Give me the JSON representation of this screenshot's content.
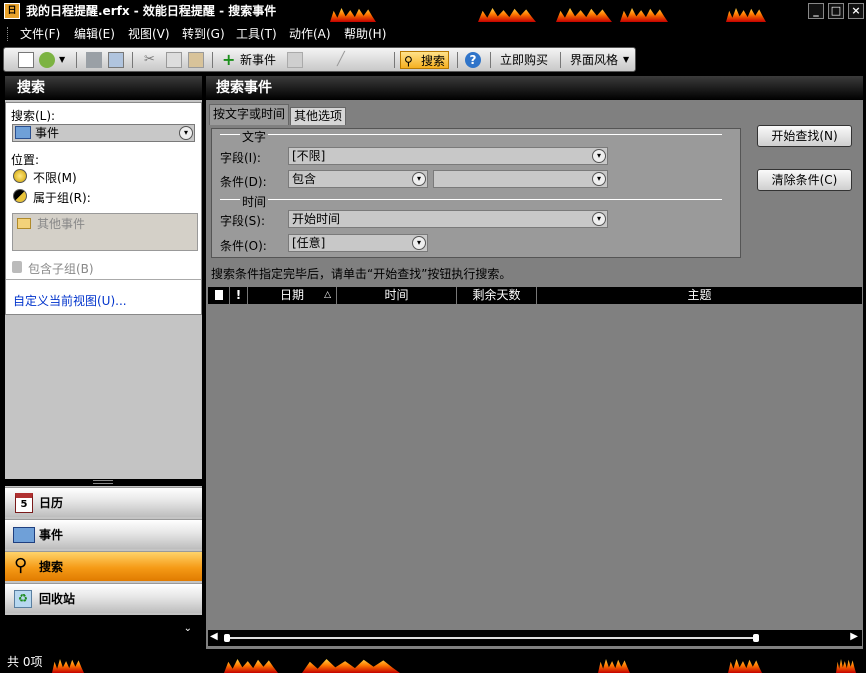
{
  "window": {
    "app_icon_text": "日",
    "title": "我的日程提醒.erfx - 效能日程提醒 - 搜索事件",
    "controls": [
      "_",
      "□",
      "×"
    ]
  },
  "menu": [
    "文件(F)",
    "编辑(E)",
    "视图(V)",
    "转到(G)",
    "工具(T)",
    "动作(A)",
    "帮助(H)"
  ],
  "toolbar": {
    "new_event": "新事件",
    "search": "搜索",
    "buy_now": "立即购买",
    "theme": "界面风格"
  },
  "sidebar": {
    "header": "搜索",
    "search_label": "搜索(L):",
    "search_value": "事件",
    "position_label": "位置:",
    "option_unlimited": "不限(M)",
    "option_group": "属于组(R):",
    "group_item": "其他事件",
    "include_subgroups": "包含子组(B)",
    "customize_link": "自定义当前视图(U)...",
    "nav": [
      "日历",
      "事件",
      "搜索",
      "回收站"
    ],
    "active_nav": "搜索",
    "calendar_icon_day": "5"
  },
  "main": {
    "header": "搜索事件",
    "tabs": [
      "按文字或时间",
      "其他选项"
    ],
    "section_text": "文字",
    "section_time": "时间",
    "field_label": "字段(I):",
    "field_value": "[不限]",
    "cond_label": "条件(D):",
    "cond_value": "包含",
    "cond_text_value": "",
    "time_field_label": "字段(S):",
    "time_field_value": "开始时间",
    "time_cond_label": "条件(O):",
    "time_cond_value": "[任意]",
    "start_button": "开始查找(N)",
    "clear_button": "清除条件(C)",
    "hint": "搜索条件指定完毕后，请单击“开始查找”按钮执行搜索。",
    "columns": [
      "日期",
      "时间",
      "剩余天数",
      "主题"
    ],
    "sort_indicator": "△"
  },
  "status": {
    "count": "共 0项"
  },
  "colors": {
    "accent_orange": "#f59a16",
    "background": "#808080",
    "chrome": "#000000"
  }
}
